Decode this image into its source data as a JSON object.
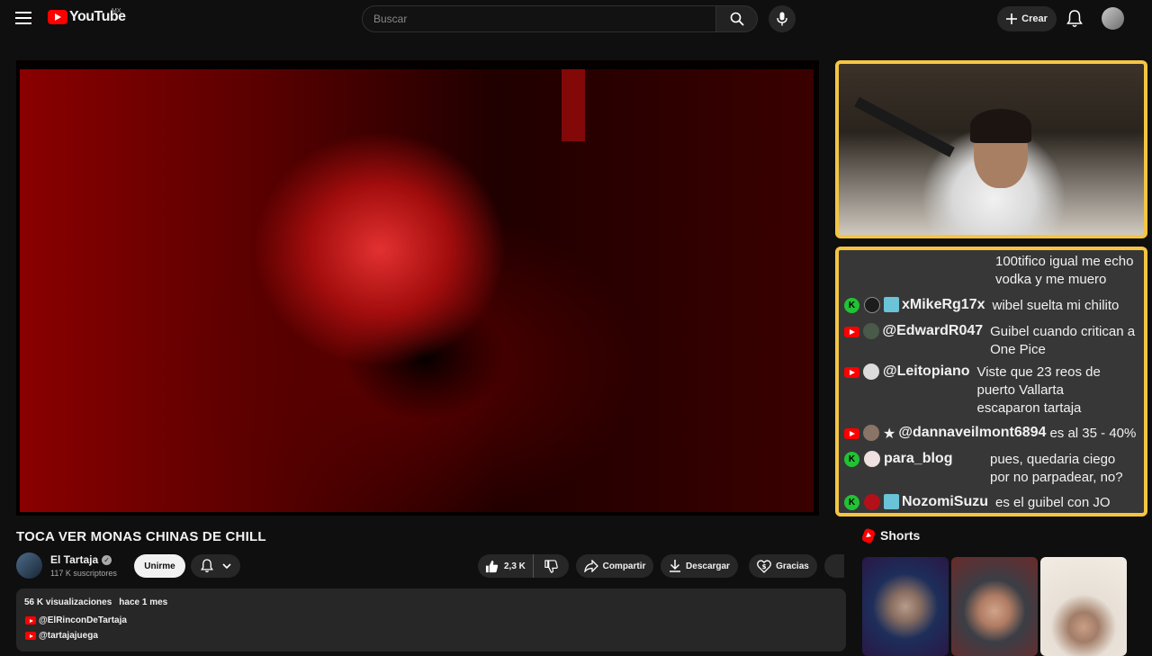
{
  "header": {
    "logo_text": "YouTube",
    "country": "MX",
    "search_placeholder": "Buscar",
    "create_label": "Crear"
  },
  "video": {
    "title": "TOCA VER MONAS CHINAS DE CHILL",
    "channel": "El Tartaja",
    "subscribers": "117 K suscriptores",
    "join_label": "Unirme",
    "likes": "2,3 K",
    "share_label": "Compartir",
    "download_label": "Descargar",
    "thanks_label": "Gracias"
  },
  "description": {
    "views": "56 K visualizaciones",
    "date": "hace 1 mes",
    "links": [
      "@ElRinconDeTartaja",
      "@tartajajuega"
    ]
  },
  "chat": {
    "messages": [
      {
        "platform": "",
        "user": "",
        "text": "100tifico igual me echo vodka y me muero"
      },
      {
        "platform": "kick",
        "user": "xMikeRg17x",
        "text": "wibel suelta mi chilito"
      },
      {
        "platform": "youtube",
        "user": "@EdwardR047",
        "text": "Guibel cuando critican a One Pice"
      },
      {
        "platform": "youtube",
        "user": "@Leitopiano",
        "text": "Viste que 23 reos de puerto Vallarta escaparon tartaja"
      },
      {
        "platform": "youtube",
        "user": "@dannaveilmont6894",
        "text": "es al 35 - 40%"
      },
      {
        "platform": "kick",
        "user": "para_blog",
        "text": "pues, quedaria ciego por no parpadear, no?"
      },
      {
        "platform": "kick",
        "user": "NozomiSuzu",
        "text": "es el guibel con JO"
      }
    ]
  },
  "shorts": {
    "heading": "Shorts"
  },
  "colors": {
    "accent": "#ff0000",
    "kick": "#21c234",
    "frame": "#f5c542"
  }
}
